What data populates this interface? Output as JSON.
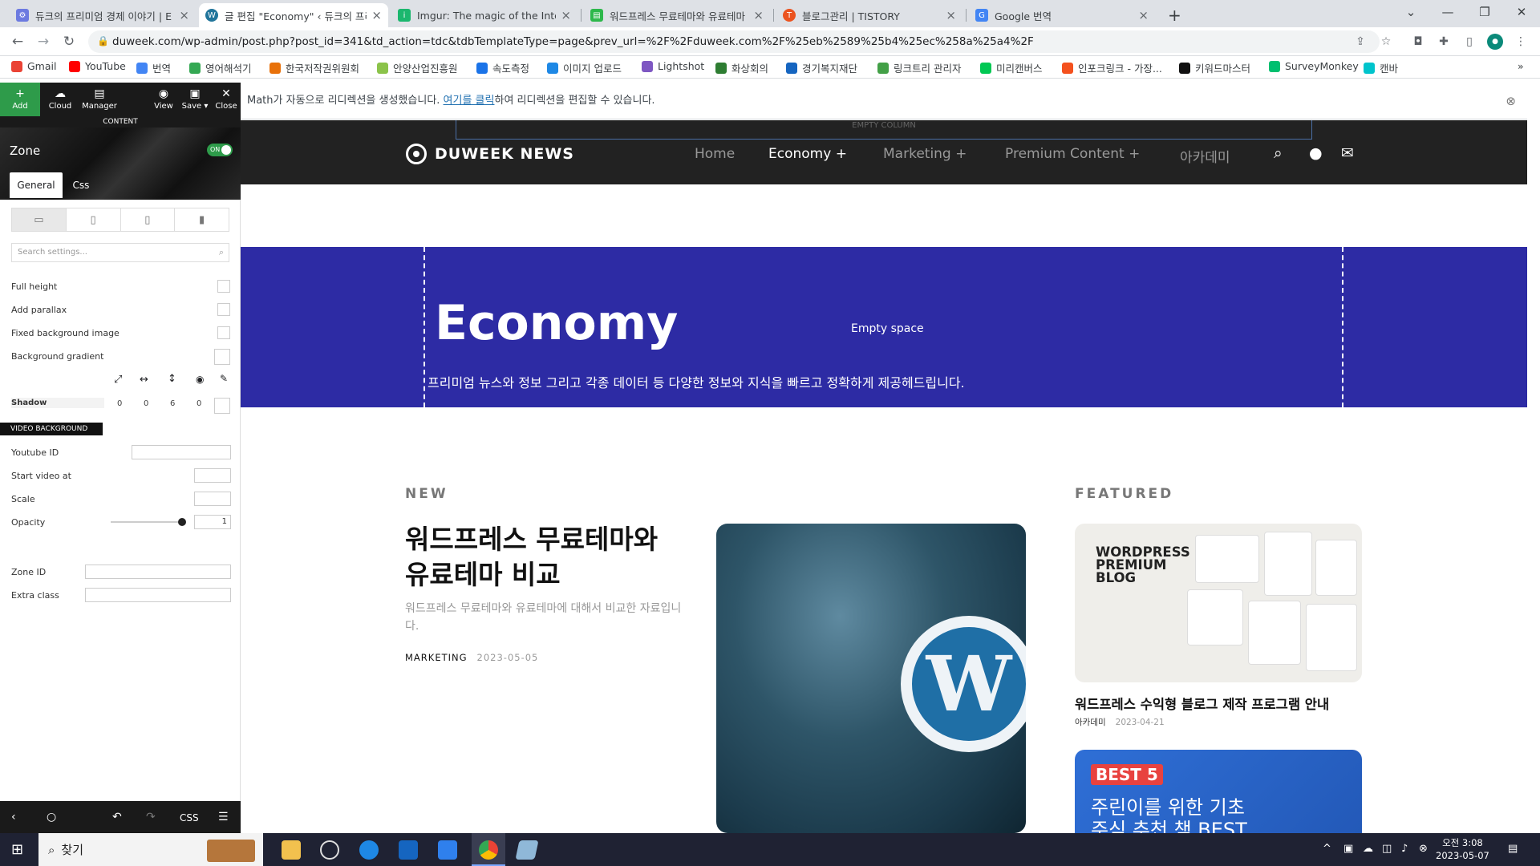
{
  "browser": {
    "tabs": [
      {
        "title": "듀크의 프리미엄 경제 이야기 | E",
        "icon": "settings-gear-icon",
        "color": "#6c7ae0"
      },
      {
        "title": "글 편집 \"Economy\" ‹ 듀크의 프리",
        "icon": "wordpress-icon",
        "color": "#21759b"
      },
      {
        "title": "Imgur: The magic of the Interne",
        "icon": "imgur-icon",
        "color": "#1bb76e"
      },
      {
        "title": "워드프레스 무료테마와 유료테마",
        "icon": "document-icon",
        "color": "#2db84b"
      },
      {
        "title": "블로그관리 | TISTORY",
        "icon": "tistory-icon",
        "color": "#eb531f"
      },
      {
        "title": "Google 번역",
        "icon": "google-translate-icon",
        "color": "#4285f4"
      }
    ],
    "new_tab": "+",
    "url": "duweek.com/wp-admin/post.php?post_id=341&td_action=tdc&tdbTemplateType=page&prev_url=%2F%2Fduweek.com%2F%25eb%2589%25b4%25ec%258a%25a4%2F",
    "bookmarks": [
      {
        "label": "Gmail",
        "color": "#ea4335"
      },
      {
        "label": "YouTube",
        "color": "#ff0000"
      },
      {
        "label": "번역",
        "color": "#4285f4"
      },
      {
        "label": "영어해석기",
        "color": "#34a853"
      },
      {
        "label": "한국저작권위원회",
        "color": "#e8710a"
      },
      {
        "label": "안양산업진흥원",
        "color": "#8bc34a"
      },
      {
        "label": "속도측정",
        "color": "#1a73e8"
      },
      {
        "label": "이미지 업로드",
        "color": "#1e88e5"
      },
      {
        "label": "Lightshot",
        "color": "#7e57c2"
      },
      {
        "label": "화상회의",
        "color": "#2e7d32"
      },
      {
        "label": "경기복지재단",
        "color": "#1565c0"
      },
      {
        "label": "링크트리 관리자",
        "color": "#43a047"
      },
      {
        "label": "미리캔버스",
        "color": "#00c853"
      },
      {
        "label": "인포크링크 - 가장...",
        "color": "#f4511e"
      },
      {
        "label": "키워드마스터",
        "color": "#111111"
      },
      {
        "label": "SurveyMonkey",
        "color": "#00bf6f"
      },
      {
        "label": "캔바",
        "color": "#00c4cc"
      }
    ],
    "bookmarks_more": "»"
  },
  "editor": {
    "toolbar": {
      "add": "Add",
      "cloud": "Cloud",
      "manager": "Manager",
      "view": "View",
      "save": "Save ▾",
      "close": "Close"
    },
    "content_label": "CONTENT",
    "zone_title": "Zone",
    "zone_toggle": "ON",
    "tabs": {
      "general": "General",
      "css": "Css"
    },
    "search_placeholder": "Search settings...",
    "options": {
      "full_height": "Full height",
      "add_parallax": "Add parallax",
      "fixed_bg": "Fixed background image",
      "bg_gradient": "Background gradient"
    },
    "shadow": {
      "label": "Shadow",
      "values": [
        "0",
        "0",
        "6",
        "0"
      ]
    },
    "video_bg": {
      "header": "VIDEO BACKGROUND",
      "youtube_id": "Youtube ID",
      "start_video": "Start video at",
      "scale": "Scale",
      "opacity": "Opacity",
      "opacity_value": "1"
    },
    "zone_id": "Zone ID",
    "extra_class": "Extra class",
    "bottom": {
      "css": "CSS"
    }
  },
  "page": {
    "notice": {
      "prefix": "Math가 자동으로 리디렉션을 생성했습니다. ",
      "link": "여기를 클릭",
      "suffix": "하여 리디렉션을 편집할 수 있습니다."
    },
    "empty_column": "EMPTY COLUMN",
    "site_name": "DUWEEK NEWS",
    "nav": [
      "Home",
      "Economy  +",
      "Marketing  +",
      "Premium Content  +",
      "아카데미"
    ],
    "hero": {
      "title": "Economy",
      "empty_space": "Empty space",
      "subtitle": "프리미엄 뉴스와 정보 그리고 각종 데이터 등 다양한 정보와 지식을 빠르고 정확하게 제공헤드립니다."
    },
    "new_label": "NEW",
    "featured_label": "FEATURED",
    "article": {
      "title": "워드프레스 무료테마와 유료테마 비교",
      "excerpt": "워드프레스 무료테마와 유료테마에 대해서 비교한 자료입니다.",
      "category": "MARKETING",
      "date": "2023-05-05"
    },
    "featured": [
      {
        "image_text": "WORDPRESS PREMIUM BLOG",
        "title": "워드프레스 수익형 블로그 제작 프로그램 안내",
        "category": "아카데미",
        "date": "2023-04-21"
      },
      {
        "badge": "BEST 5",
        "line1": "주린이를 위한 기초",
        "line2": "주식 추천 책 BEST"
      }
    ]
  },
  "taskbar": {
    "search": "찾기",
    "time": "오전 3:08",
    "date": "2023-05-07"
  }
}
